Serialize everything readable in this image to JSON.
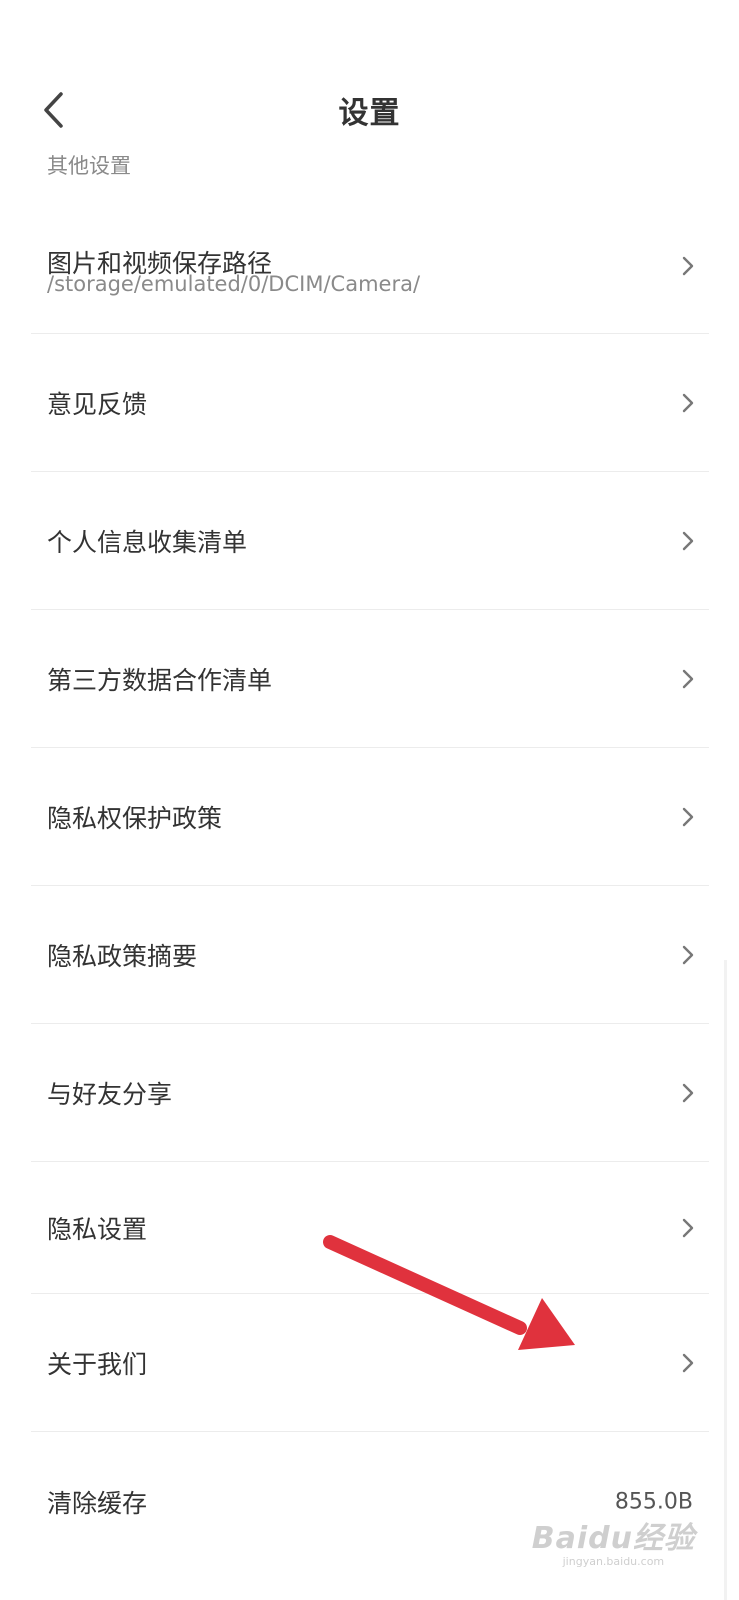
{
  "header": {
    "title": "设置"
  },
  "section_label": "其他设置",
  "rows": [
    {
      "label": "图片和视频保存路径",
      "sub": "/storage/emulated/0/DCIM/Camera/"
    },
    {
      "label": "意见反馈"
    },
    {
      "label": "个人信息收集清单"
    },
    {
      "label": "第三方数据合作清单"
    },
    {
      "label": "隐私权保护政策"
    },
    {
      "label": "隐私政策摘要"
    },
    {
      "label": "与好友分享"
    },
    {
      "label": "隐私设置"
    },
    {
      "label": "关于我们"
    },
    {
      "label": "清除缓存",
      "value": "855.0B"
    }
  ],
  "annotation": {
    "arrow_color": "#e0323d"
  },
  "watermark": {
    "main": "Baidu经验",
    "sub": "jingyan.baidu.com"
  }
}
